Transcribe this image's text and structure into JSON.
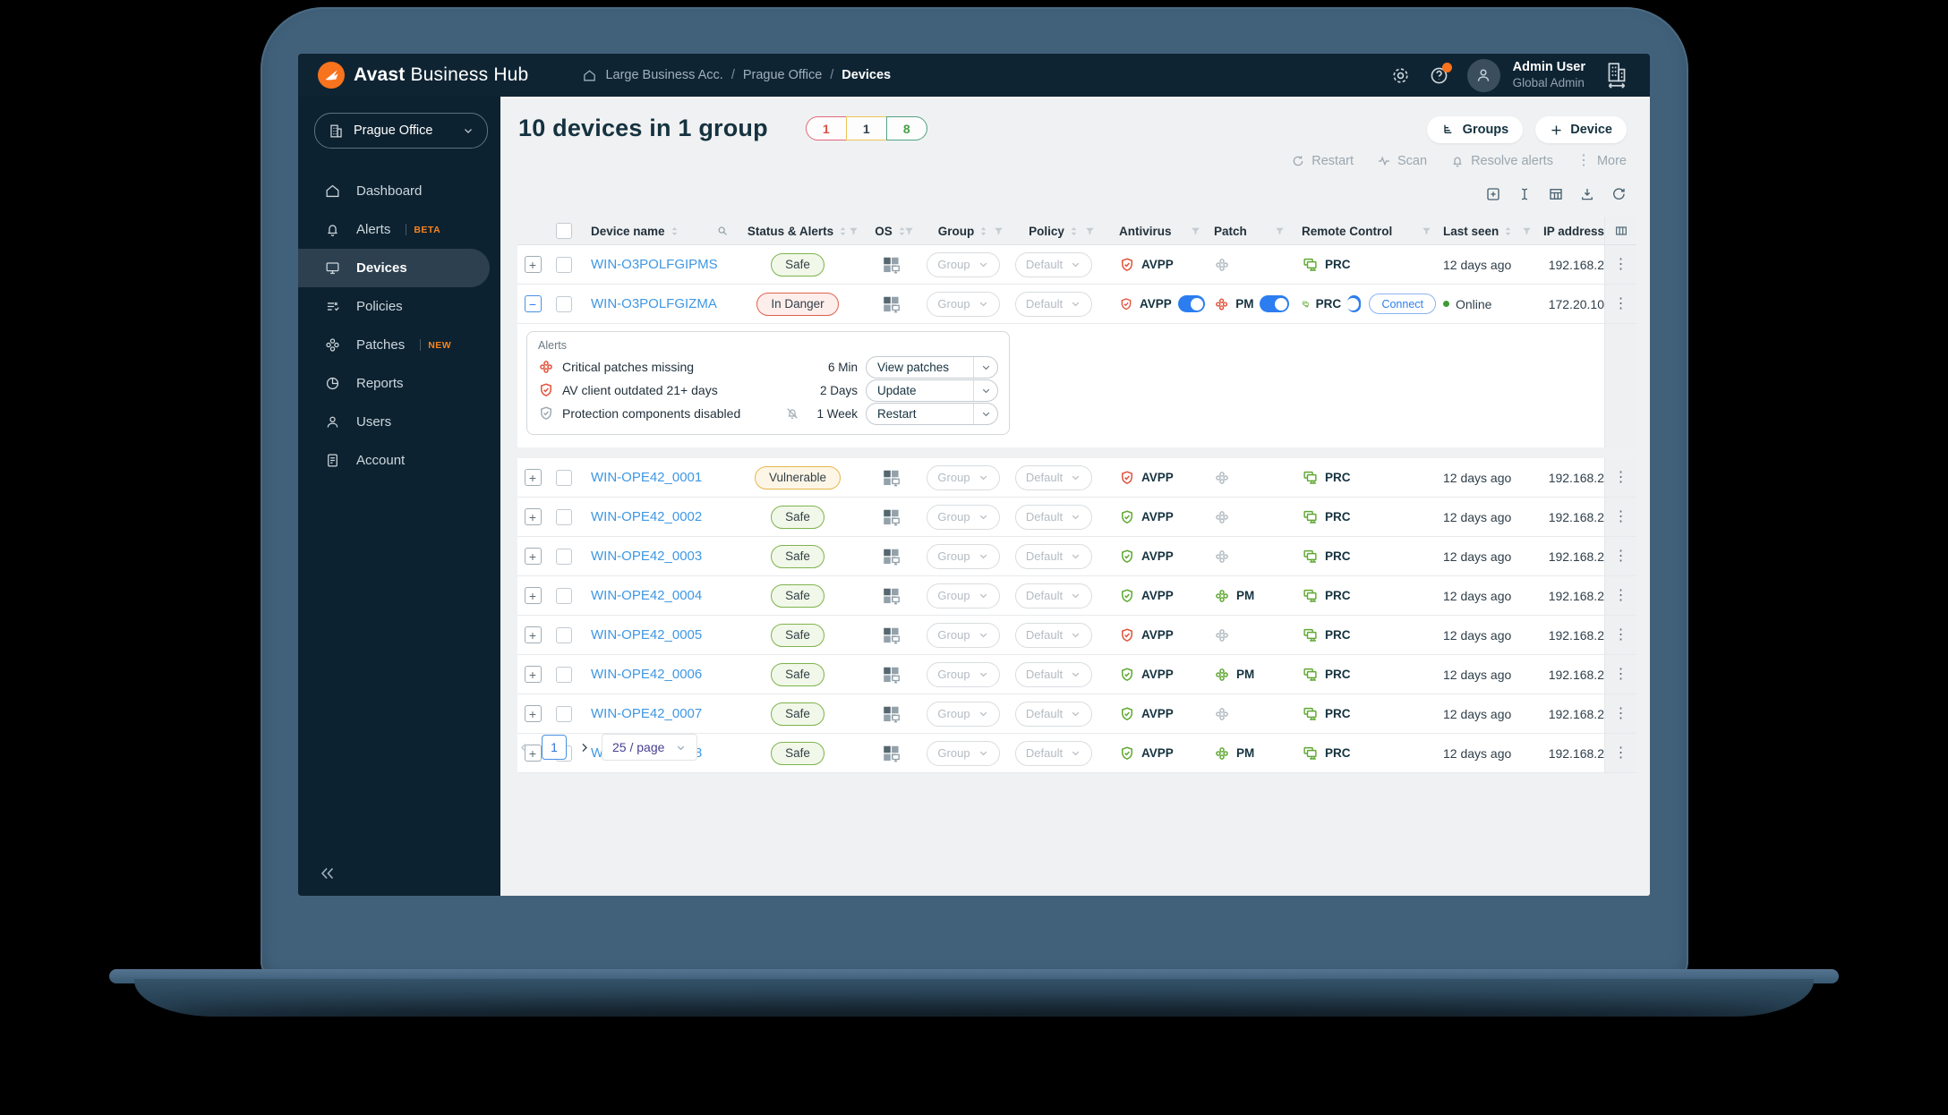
{
  "colors": {
    "accent_orange": "#f7731d",
    "toggle_blue": "#2b7df0",
    "safe_green": "#5fa832",
    "alert_red": "#e2523c",
    "warn_amber": "#e8b64c",
    "link_blue": "#3f97e3"
  },
  "topbar": {
    "brand_bold": "Avast",
    "brand_rest": "Business Hub",
    "breadcrumb": {
      "separator": "/",
      "items": [
        "Large Business Acc.",
        "Prague Office",
        "Devices"
      ]
    },
    "user": {
      "name": "Admin User",
      "role": "Global Admin"
    }
  },
  "sidebar": {
    "org_selector": "Prague Office",
    "items": [
      {
        "label": "Dashboard",
        "icon": "home",
        "badge": "",
        "active": false
      },
      {
        "label": "Alerts",
        "icon": "bell",
        "badge": "BETA",
        "active": false
      },
      {
        "label": "Devices",
        "icon": "monitor",
        "badge": "",
        "active": true
      },
      {
        "label": "Policies",
        "icon": "policies",
        "badge": "",
        "active": false
      },
      {
        "label": "Patches",
        "icon": "patch",
        "badge": "NEW",
        "active": false
      },
      {
        "label": "Reports",
        "icon": "pie",
        "badge": "",
        "active": false
      },
      {
        "label": "Users",
        "icon": "person",
        "badge": "",
        "active": false
      },
      {
        "label": "Account",
        "icon": "doc",
        "badge": "",
        "active": false
      }
    ]
  },
  "header": {
    "title": "10 devices in 1 group",
    "status_counts": [
      {
        "value": "1",
        "color": "red"
      },
      {
        "value": "1",
        "color": "amber"
      },
      {
        "value": "8",
        "color": "green"
      }
    ],
    "groups_button": "Groups",
    "device_button": "Device"
  },
  "toolbar": {
    "actions": [
      "Restart",
      "Scan",
      "Resolve alerts",
      "More"
    ]
  },
  "table": {
    "columns": [
      "Device name",
      "Status & Alerts",
      "OS",
      "Group",
      "Policy",
      "Antivirus",
      "Patch",
      "Remote Control",
      "Last seen",
      "IP address"
    ],
    "group_placeholder": "Group",
    "policy_placeholder": "Default",
    "connect_label": "Connect",
    "expand_collapsed": "+",
    "expand_expanded": "−",
    "rows": [
      {
        "name": "WIN-O3POLFGIPMS",
        "status": "Safe",
        "status_type": "safe",
        "expanded": false,
        "av": {
          "label": "AVPP",
          "color": "red",
          "toggle": false
        },
        "patch": {
          "label": "",
          "color": "gray",
          "toggle": false
        },
        "remote": {
          "label": "PRC",
          "toggle": false,
          "connect": false
        },
        "last_seen": "12 days ago",
        "online": false,
        "ip": "192.168.2"
      },
      {
        "name": "WIN-O3POLFGIZMA",
        "status": "In Danger",
        "status_type": "danger",
        "expanded": true,
        "av": {
          "label": "AVPP",
          "color": "red",
          "toggle": true
        },
        "patch": {
          "label": "PM",
          "color": "red",
          "toggle": true
        },
        "remote": {
          "label": "PRC",
          "toggle": true,
          "connect": true
        },
        "last_seen": "Online",
        "online": true,
        "ip": "172.20.10"
      },
      {
        "name": "WIN-OPE42_0001",
        "status": "Vulnerable",
        "status_type": "vulnerable",
        "expanded": false,
        "av": {
          "label": "AVPP",
          "color": "red",
          "toggle": false
        },
        "patch": {
          "label": "",
          "color": "gray",
          "toggle": false
        },
        "remote": {
          "label": "PRC",
          "toggle": false,
          "connect": false
        },
        "last_seen": "12 days ago",
        "online": false,
        "ip": "192.168.2"
      },
      {
        "name": "WIN-OPE42_0002",
        "status": "Safe",
        "status_type": "safe",
        "expanded": false,
        "av": {
          "label": "AVPP",
          "color": "green",
          "toggle": false
        },
        "patch": {
          "label": "",
          "color": "gray",
          "toggle": false
        },
        "remote": {
          "label": "PRC",
          "toggle": false,
          "connect": false
        },
        "last_seen": "12 days ago",
        "online": false,
        "ip": "192.168.2"
      },
      {
        "name": "WIN-OPE42_0003",
        "status": "Safe",
        "status_type": "safe",
        "expanded": false,
        "av": {
          "label": "AVPP",
          "color": "green",
          "toggle": false
        },
        "patch": {
          "label": "",
          "color": "gray",
          "toggle": false
        },
        "remote": {
          "label": "PRC",
          "toggle": false,
          "connect": false
        },
        "last_seen": "12 days ago",
        "online": false,
        "ip": "192.168.2"
      },
      {
        "name": "WIN-OPE42_0004",
        "status": "Safe",
        "status_type": "safe",
        "expanded": false,
        "av": {
          "label": "AVPP",
          "color": "green",
          "toggle": false
        },
        "patch": {
          "label": "PM",
          "color": "green",
          "toggle": false
        },
        "remote": {
          "label": "PRC",
          "toggle": false,
          "connect": false
        },
        "last_seen": "12 days ago",
        "online": false,
        "ip": "192.168.2"
      },
      {
        "name": "WIN-OPE42_0005",
        "status": "Safe",
        "status_type": "safe",
        "expanded": false,
        "av": {
          "label": "AVPP",
          "color": "red",
          "toggle": false
        },
        "patch": {
          "label": "",
          "color": "gray",
          "toggle": false
        },
        "remote": {
          "label": "PRC",
          "toggle": false,
          "connect": false
        },
        "last_seen": "12 days ago",
        "online": false,
        "ip": "192.168.2"
      },
      {
        "name": "WIN-OPE42_0006",
        "status": "Safe",
        "status_type": "safe",
        "expanded": false,
        "av": {
          "label": "AVPP",
          "color": "green",
          "toggle": false
        },
        "patch": {
          "label": "PM",
          "color": "green",
          "toggle": false
        },
        "remote": {
          "label": "PRC",
          "toggle": false,
          "connect": false
        },
        "last_seen": "12 days ago",
        "online": false,
        "ip": "192.168.2"
      },
      {
        "name": "WIN-OPE42_0007",
        "status": "Safe",
        "status_type": "safe",
        "expanded": false,
        "av": {
          "label": "AVPP",
          "color": "green",
          "toggle": false
        },
        "patch": {
          "label": "",
          "color": "gray",
          "toggle": false
        },
        "remote": {
          "label": "PRC",
          "toggle": false,
          "connect": false
        },
        "last_seen": "12 days ago",
        "online": false,
        "ip": "192.168.2"
      },
      {
        "name": "WIN-OPE42_0008",
        "status": "Safe",
        "status_type": "safe",
        "expanded": false,
        "av": {
          "label": "AVPP",
          "color": "green",
          "toggle": false
        },
        "patch": {
          "label": "PM",
          "color": "green",
          "toggle": false
        },
        "remote": {
          "label": "PRC",
          "toggle": false,
          "connect": false
        },
        "last_seen": "12 days ago",
        "online": false,
        "ip": "192.168.2"
      }
    ]
  },
  "alerts_panel": {
    "title": "Alerts",
    "items": [
      {
        "icon": "patch-red",
        "text": "Critical patches missing",
        "muted": false,
        "age": "6 Min",
        "action": "View patches"
      },
      {
        "icon": "shield-red",
        "text": "AV client outdated 21+ days",
        "muted": false,
        "age": "2 Days",
        "action": "Update"
      },
      {
        "icon": "shield-gray",
        "text": "Protection components disabled",
        "muted": true,
        "age": "1 Week",
        "action": "Restart"
      }
    ]
  },
  "pagination": {
    "page": "1",
    "page_size": "25 / page"
  }
}
